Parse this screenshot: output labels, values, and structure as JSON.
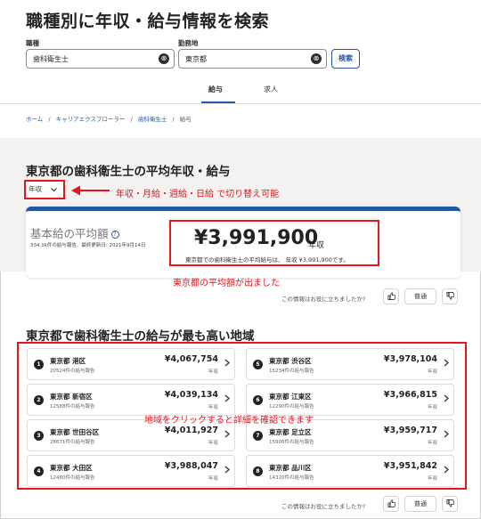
{
  "page": {
    "title": "職種別に年収・給与情報を検索"
  },
  "search": {
    "job_label": "職種",
    "job_value": "歯科衛生士",
    "location_label": "勤務地",
    "location_value": "東京都",
    "clear_icon": "⊗",
    "button_label": "検索"
  },
  "tabs": [
    {
      "label": "給与",
      "active": true
    },
    {
      "label": "求人",
      "active": false
    }
  ],
  "breadcrumb": {
    "items": [
      "ホーム",
      "キャリアエクスプローラー",
      "歯科衛生士",
      "給与"
    ],
    "separator": "/"
  },
  "average": {
    "heading": "東京都の歯科衛生士の平均年収・給与",
    "period_select": "年収",
    "period_annotation": "年収・月給・週給・日給 で切り替え可能",
    "card_title": "基本給の平均額",
    "card_sub": "334.1k件の給与報告、最終更新日: 2021年9月14日",
    "amount": "¥3,991,900",
    "amount_unit": "年収",
    "amount_note": "東京都での歯科衛生士の平均給与は、 年収 ¥3,991,900です。",
    "amount_annotation": "東京都の平均額が出ました"
  },
  "feedback": {
    "question": "この情報はお役に立ちましたか?",
    "neutral_label": "普通",
    "thumbs_up_icon": "thumbs-up-icon",
    "thumbs_down_icon": "thumbs-down-icon"
  },
  "regions": {
    "heading": "東京都で歯科衛生士の給与が最も高い地域",
    "annotation": "地域をクリックすると詳細を確認できます",
    "items": [
      {
        "rank": "1",
        "name": "東京都 港区",
        "reports": "20524件の給与報告",
        "amount": "¥4,067,754",
        "unit": "年収"
      },
      {
        "rank": "2",
        "name": "東京都 新宿区",
        "reports": "12588件の給与報告",
        "amount": "¥4,039,134",
        "unit": "年収"
      },
      {
        "rank": "3",
        "name": "東京都 世田谷区",
        "reports": "28671件の給与報告",
        "amount": "¥4,011,927",
        "unit": "年収"
      },
      {
        "rank": "4",
        "name": "東京都 大田区",
        "reports": "12480件の給与報告",
        "amount": "¥3,988,047",
        "unit": "年収"
      },
      {
        "rank": "5",
        "name": "東京都 渋谷区",
        "reports": "15234件の給与報告",
        "amount": "¥3,978,104",
        "unit": "年収"
      },
      {
        "rank": "6",
        "name": "東京都 江東区",
        "reports": "12290件の給与報告",
        "amount": "¥3,966,815",
        "unit": "年収"
      },
      {
        "rank": "7",
        "name": "東京都 足立区",
        "reports": "15906件の給与報告",
        "amount": "¥3,959,717",
        "unit": "年収"
      },
      {
        "rank": "8",
        "name": "東京都 品川区",
        "reports": "14320件の給与報告",
        "amount": "¥3,951,842",
        "unit": "年収"
      }
    ]
  },
  "colors": {
    "accent": "#2557a7",
    "annotation_red": "#e8141c",
    "band_gray": "#f3f2f1"
  }
}
